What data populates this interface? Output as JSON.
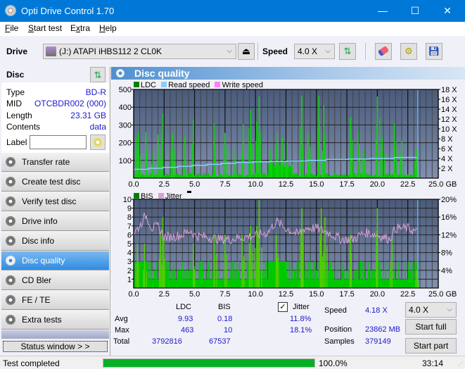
{
  "window": {
    "title": "Opti Drive Control 1.70",
    "minimize": "—",
    "maximize": "☐",
    "close": "✕"
  },
  "menu": [
    "File",
    "Start test",
    "Extra",
    "Help"
  ],
  "toolbar": {
    "drive_label": "Drive",
    "drive_value": "(J:)  ATAPI iHBS112  2 CL0K",
    "speed_label": "Speed",
    "speed_value": "4.0 X"
  },
  "disc": {
    "header": "Disc",
    "fields": [
      {
        "key": "Type",
        "value": "BD-R"
      },
      {
        "key": "MID",
        "value": "OTCBDR002 (000)"
      },
      {
        "key": "Length",
        "value": "23.31 GB"
      },
      {
        "key": "Contents",
        "value": "data"
      }
    ],
    "label_key": "Label",
    "label_value": ""
  },
  "nav": [
    {
      "label": "Transfer rate",
      "active": false
    },
    {
      "label": "Create test disc",
      "active": false
    },
    {
      "label": "Verify test disc",
      "active": false
    },
    {
      "label": "Drive info",
      "active": false
    },
    {
      "label": "Disc info",
      "active": false
    },
    {
      "label": "Disc quality",
      "active": true
    },
    {
      "label": "CD Bler",
      "active": false
    },
    {
      "label": "FE / TE",
      "active": false
    },
    {
      "label": "Extra tests",
      "active": false
    }
  ],
  "status_window_button": "Status window > >",
  "panel_title": "Disc quality",
  "colors": {
    "ldc": "#00c800",
    "read_speed": "#87cefa",
    "write_speed": "#ff80ff",
    "bis": "#00c800",
    "jitter": "#d8a0d8",
    "plot_bg_top": "#4a5a7a",
    "plot_bg_bottom": "#8090b0"
  },
  "chart_data": [
    {
      "type": "bar",
      "title": "LDC / Read speed",
      "legend": [
        "LDC",
        "Read speed",
        "Write speed"
      ],
      "xlabel": "GB",
      "x_ticks": [
        "0.0",
        "2.5",
        "5.0",
        "7.5",
        "10.0",
        "12.5",
        "15.0",
        "17.5",
        "20.0",
        "22.5",
        "25.0 GB"
      ],
      "xlim": [
        0,
        25
      ],
      "y_left_ticks": [
        "500",
        "400",
        "300",
        "200",
        "100"
      ],
      "ylim_left": [
        0,
        500
      ],
      "y_right_ticks": [
        "18 X",
        "16 X",
        "14 X",
        "12 X",
        "10 X",
        "8 X",
        "6 X",
        "4 X",
        "2 X"
      ],
      "ylim_right": [
        0,
        18
      ],
      "end_marker_gb": 23.31,
      "ldc_peaks": [
        {
          "x": 0.2,
          "y": 230
        },
        {
          "x": 0.4,
          "y": 260
        },
        {
          "x": 1.0,
          "y": 260
        },
        {
          "x": 1.6,
          "y": 155
        },
        {
          "x": 2.0,
          "y": 245
        },
        {
          "x": 2.4,
          "y": 365
        },
        {
          "x": 3.2,
          "y": 255
        },
        {
          "x": 4.2,
          "y": 235
        },
        {
          "x": 4.9,
          "y": 330
        },
        {
          "x": 6.6,
          "y": 310
        },
        {
          "x": 7.5,
          "y": 255
        },
        {
          "x": 8.2,
          "y": 175
        },
        {
          "x": 9.0,
          "y": 305
        },
        {
          "x": 9.6,
          "y": 385
        },
        {
          "x": 10.1,
          "y": 320
        },
        {
          "x": 10.3,
          "y": 460
        },
        {
          "x": 11.2,
          "y": 160
        },
        {
          "x": 11.8,
          "y": 255
        },
        {
          "x": 12.2,
          "y": 230
        },
        {
          "x": 12.6,
          "y": 200
        },
        {
          "x": 13.8,
          "y": 465
        },
        {
          "x": 14.3,
          "y": 255
        },
        {
          "x": 15.2,
          "y": 465
        },
        {
          "x": 15.6,
          "y": 410
        },
        {
          "x": 17.8,
          "y": 340
        },
        {
          "x": 18.4,
          "y": 270
        },
        {
          "x": 18.9,
          "y": 160
        },
        {
          "x": 20.0,
          "y": 460
        },
        {
          "x": 20.4,
          "y": 225
        },
        {
          "x": 21.4,
          "y": 310
        },
        {
          "x": 22.0,
          "y": 210
        },
        {
          "x": 23.2,
          "y": 160
        }
      ],
      "read_speed": [
        {
          "x": 0.0,
          "y": 1.8
        },
        {
          "x": 1.2,
          "y": 2.0
        },
        {
          "x": 2.4,
          "y": 2.2
        },
        {
          "x": 3.6,
          "y": 2.4
        },
        {
          "x": 4.8,
          "y": 2.6
        },
        {
          "x": 6.0,
          "y": 2.8
        },
        {
          "x": 7.2,
          "y": 3.0
        },
        {
          "x": 8.4,
          "y": 3.2
        },
        {
          "x": 9.8,
          "y": 3.3
        },
        {
          "x": 11.2,
          "y": 3.4
        },
        {
          "x": 12.6,
          "y": 3.5
        },
        {
          "x": 14.2,
          "y": 3.6
        },
        {
          "x": 15.8,
          "y": 3.8
        },
        {
          "x": 17.6,
          "y": 3.9
        },
        {
          "x": 19.4,
          "y": 4.0
        },
        {
          "x": 21.4,
          "y": 4.2
        },
        {
          "x": 23.31,
          "y": 4.2
        }
      ]
    },
    {
      "type": "bar",
      "title": "BIS / Jitter",
      "legend": [
        "BIS",
        "Jitter"
      ],
      "xlabel": "GB",
      "x_ticks": [
        "0.0",
        "2.5",
        "5.0",
        "7.5",
        "10.0",
        "12.5",
        "15.0",
        "17.5",
        "20.0",
        "22.5",
        "25.0 GB"
      ],
      "xlim": [
        0,
        25
      ],
      "y_left_ticks": [
        "10",
        "9",
        "8",
        "7",
        "6",
        "5",
        "4",
        "3",
        "2",
        "1"
      ],
      "ylim_left": [
        0,
        10
      ],
      "y_right_ticks": [
        "20%",
        "16%",
        "12%",
        "8%",
        "4%"
      ],
      "ylim_right": [
        0,
        20
      ],
      "end_marker_gb": 23.31,
      "bis_peaks": [
        {
          "x": 0.3,
          "y": 5
        },
        {
          "x": 0.9,
          "y": 5
        },
        {
          "x": 2.2,
          "y": 6
        },
        {
          "x": 2.4,
          "y": 8
        },
        {
          "x": 4.9,
          "y": 5
        },
        {
          "x": 6.6,
          "y": 6
        },
        {
          "x": 7.5,
          "y": 6
        },
        {
          "x": 8.9,
          "y": 6
        },
        {
          "x": 9.6,
          "y": 7
        },
        {
          "x": 10.1,
          "y": 7
        },
        {
          "x": 10.3,
          "y": 10
        },
        {
          "x": 11.7,
          "y": 6
        },
        {
          "x": 13.8,
          "y": 9
        },
        {
          "x": 15.4,
          "y": 9
        },
        {
          "x": 15.7,
          "y": 8
        },
        {
          "x": 17.8,
          "y": 6
        },
        {
          "x": 20.0,
          "y": 9
        },
        {
          "x": 21.2,
          "y": 6
        },
        {
          "x": 23.2,
          "y": 2
        }
      ],
      "jitter": [
        {
          "x": 0.0,
          "y": 12.3
        },
        {
          "x": 0.5,
          "y": 14.0
        },
        {
          "x": 1.0,
          "y": 16.5
        },
        {
          "x": 1.5,
          "y": 13.5
        },
        {
          "x": 2.0,
          "y": 13.8
        },
        {
          "x": 2.5,
          "y": 11.5
        },
        {
          "x": 3.0,
          "y": 11.5
        },
        {
          "x": 4.0,
          "y": 12.0
        },
        {
          "x": 4.7,
          "y": 13.0
        },
        {
          "x": 5.0,
          "y": 11.8
        },
        {
          "x": 6.0,
          "y": 11.5
        },
        {
          "x": 7.0,
          "y": 11.0
        },
        {
          "x": 8.0,
          "y": 11.0
        },
        {
          "x": 9.0,
          "y": 11.5
        },
        {
          "x": 10.0,
          "y": 11.8
        },
        {
          "x": 11.0,
          "y": 12.5
        },
        {
          "x": 11.7,
          "y": 15.0
        },
        {
          "x": 12.5,
          "y": 13.5
        },
        {
          "x": 13.5,
          "y": 12.0
        },
        {
          "x": 14.0,
          "y": 13.5
        },
        {
          "x": 15.0,
          "y": 13.5
        },
        {
          "x": 16.0,
          "y": 12.5
        },
        {
          "x": 17.0,
          "y": 11.0
        },
        {
          "x": 18.0,
          "y": 11.0
        },
        {
          "x": 19.0,
          "y": 12.5
        },
        {
          "x": 20.0,
          "y": 12.0
        },
        {
          "x": 21.0,
          "y": 11.0
        },
        {
          "x": 21.5,
          "y": 13.5
        },
        {
          "x": 22.5,
          "y": 13.5
        },
        {
          "x": 23.3,
          "y": 12.5
        }
      ]
    }
  ],
  "stats": {
    "col_ldc": "LDC",
    "col_bis": "BIS",
    "jitter_label": "Jitter",
    "jitter_checked": true,
    "rows": [
      {
        "label": "Avg",
        "ldc": "9.93",
        "bis": "0.18",
        "jitter": "11.8%"
      },
      {
        "label": "Max",
        "ldc": "463",
        "bis": "10",
        "jitter": "18.1%"
      },
      {
        "label": "Total",
        "ldc": "3792816",
        "bis": "67537",
        "jitter": ""
      }
    ],
    "speed_label": "Speed",
    "speed_value": "4.18 X",
    "position_label": "Position",
    "position_value": "23862 MB",
    "samples_label": "Samples",
    "samples_value": "379149",
    "speed_select": "4.0 X",
    "start_full": "Start full",
    "start_part": "Start part"
  },
  "statusbar": {
    "message": "Test completed",
    "progress_percent": 100,
    "progress_text": "100.0%",
    "elapsed": "33:14"
  }
}
